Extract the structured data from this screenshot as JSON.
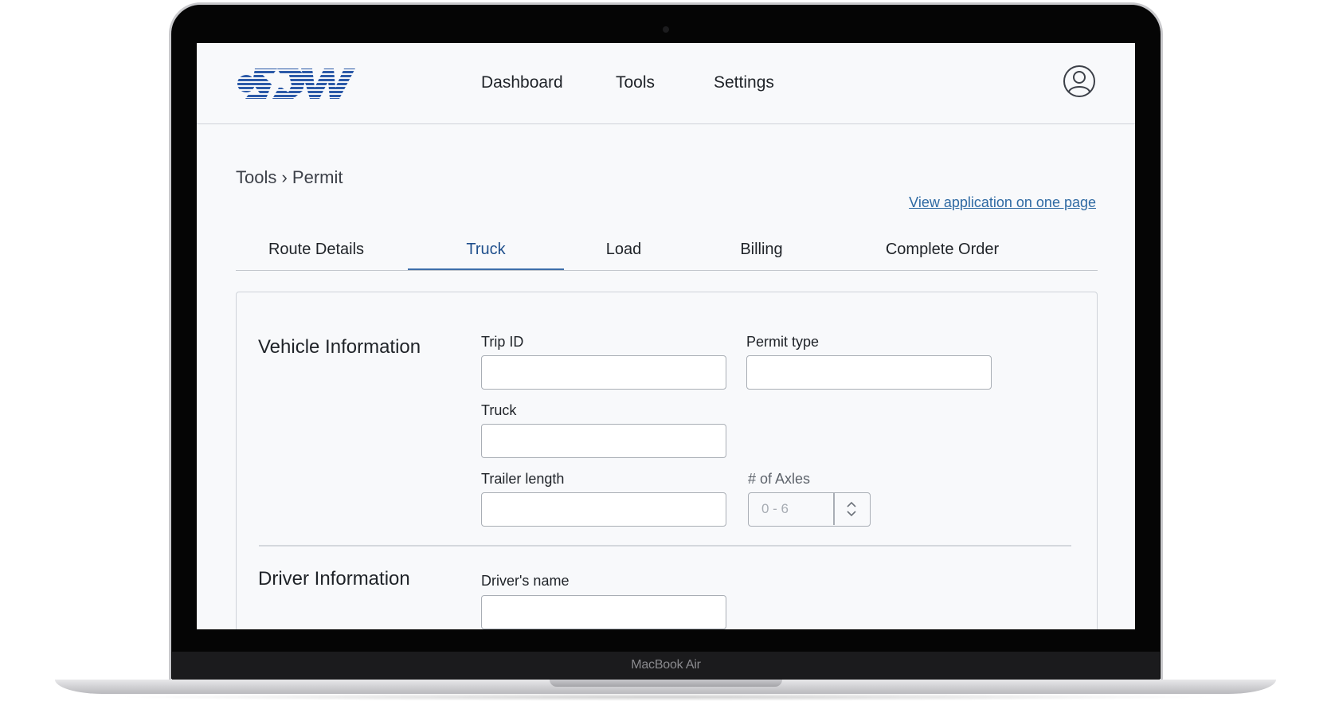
{
  "device": {
    "label": "MacBook Air"
  },
  "nav": {
    "links": [
      "Dashboard",
      "Tools",
      "Settings"
    ]
  },
  "breadcrumb": "Tools › Permit",
  "view_link": "View application on one page",
  "tabs": [
    {
      "label": "Route Details",
      "active": false
    },
    {
      "label": "Truck",
      "active": true
    },
    {
      "label": "Load",
      "active": false
    },
    {
      "label": "Billing",
      "active": false
    },
    {
      "label": "Complete Order",
      "active": false
    }
  ],
  "vehicle": {
    "title": "Vehicle Information",
    "trip_id_label": "Trip ID",
    "permit_type_label": "Permit type",
    "truck_label": "Truck",
    "trailer_length_label": "Trailer length",
    "axles_label": "# of Axles",
    "axles_placeholder": "0 - 6"
  },
  "driver": {
    "title": "Driver Information",
    "name_label": "Driver's name"
  },
  "colors": {
    "accent": "#1f4f8c",
    "link": "#2f6aa3",
    "logo": "#2c5aa8"
  },
  "icons": {
    "avatar": "user-circle-icon",
    "stepper": "chevron-up-down-icon"
  }
}
